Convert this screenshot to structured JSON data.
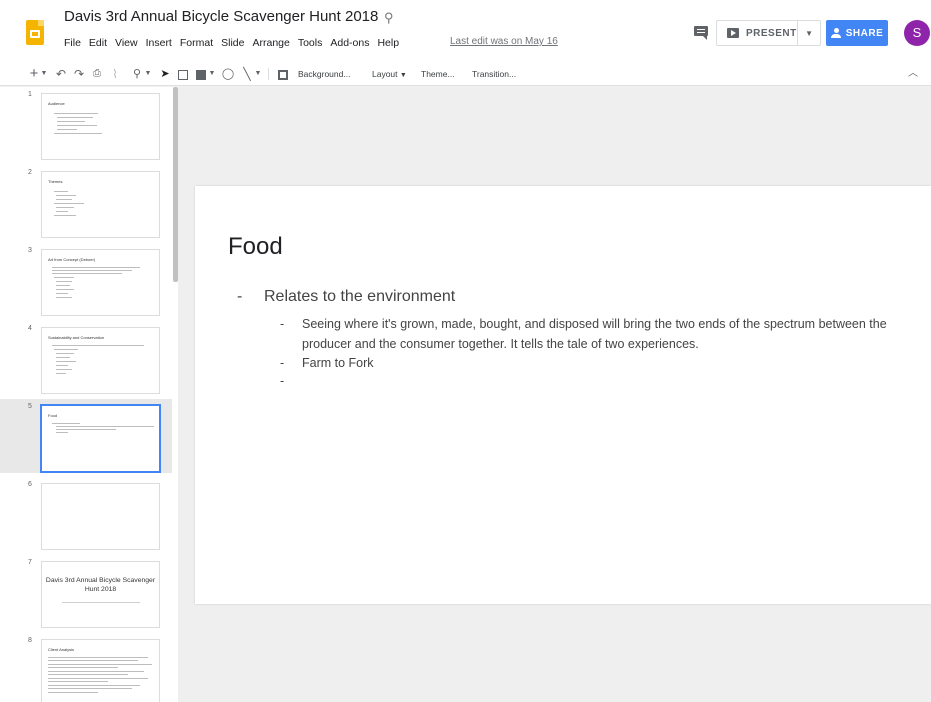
{
  "header": {
    "doc_title": "Davis 3rd Annual Bicycle Scavenger Hunt 2018",
    "menu": [
      "File",
      "Edit",
      "View",
      "Insert",
      "Format",
      "Slide",
      "Arrange",
      "Tools",
      "Add-ons",
      "Help"
    ],
    "last_edit": "Last edit was on May 16",
    "present_label": "PRESENT",
    "share_label": "SHARE",
    "avatar_initial": "S",
    "accent_color": "#4285f4",
    "avatar_color": "#8e24aa"
  },
  "toolbar": {
    "background_label": "Background...",
    "layout_label": "Layout",
    "theme_label": "Theme...",
    "transition_label": "Transition..."
  },
  "filmstrip": {
    "slides": [
      {
        "num": "1",
        "title": "Audience"
      },
      {
        "num": "2",
        "title": "Themes"
      },
      {
        "num": "3",
        "title": "Art from Concept (Deboer)"
      },
      {
        "num": "4",
        "title": "Sustainability and Conservation"
      },
      {
        "num": "5",
        "title": "Food"
      },
      {
        "num": "6",
        "title": ""
      },
      {
        "num": "7",
        "title": "Davis 3rd Annual Bicycle Scavenger Hunt 2018"
      },
      {
        "num": "8",
        "title": "Client Analysis"
      }
    ],
    "selected_index": 5
  },
  "slide": {
    "title": "Food",
    "bullet": "Relates to the environment",
    "sub_bullets": [
      "Seeing where it's grown, made, bought, and disposed will bring the two ends of the spectrum between the producer and the consumer together. It tells the tale of two experiences.",
      "Farm to Fork",
      ""
    ],
    "dash": "-"
  }
}
